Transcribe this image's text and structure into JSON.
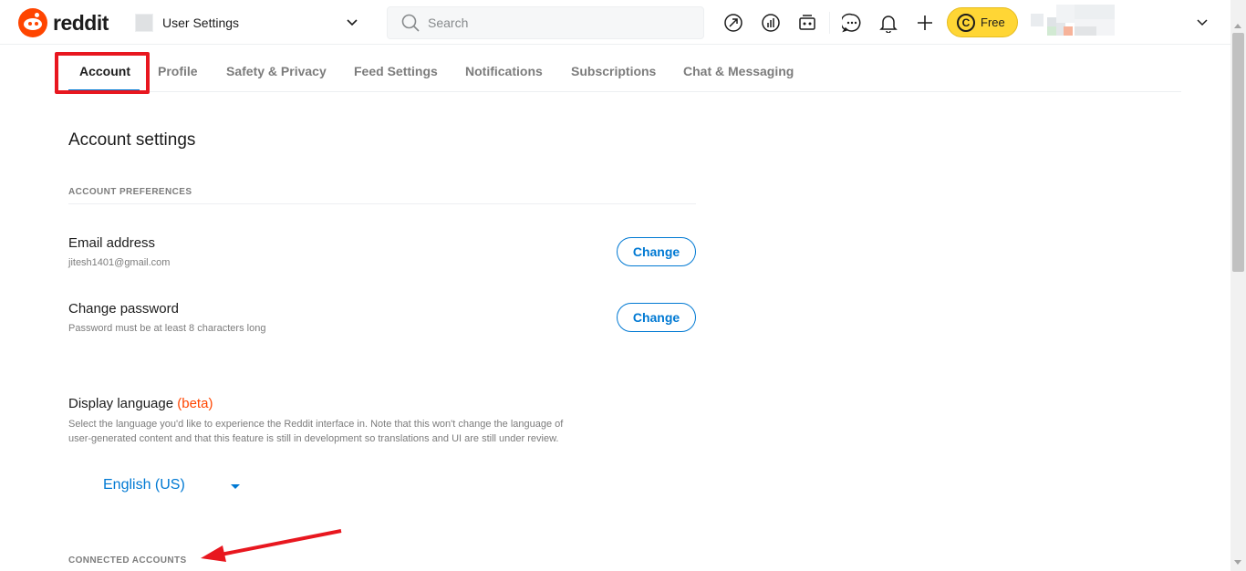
{
  "header": {
    "logo_text": "reddit",
    "community_label": "User Settings",
    "search_placeholder": "Search",
    "coins_label": "Free",
    "coins_symbol": "C"
  },
  "tabs": [
    {
      "label": "Account",
      "active": true
    },
    {
      "label": "Profile",
      "active": false
    },
    {
      "label": "Safety & Privacy",
      "active": false
    },
    {
      "label": "Feed Settings",
      "active": false
    },
    {
      "label": "Notifications",
      "active": false
    },
    {
      "label": "Subscriptions",
      "active": false
    },
    {
      "label": "Chat & Messaging",
      "active": false
    }
  ],
  "page": {
    "title": "Account settings",
    "preferences_header": "ACCOUNT PREFERENCES",
    "email": {
      "title": "Email address",
      "value": "jitesh1401@gmail.com",
      "button": "Change"
    },
    "password": {
      "title": "Change password",
      "hint": "Password must be at least 8 characters long",
      "button": "Change"
    },
    "language": {
      "title": "Display language",
      "badge": "(beta)",
      "description": "Select the language you'd like to experience the Reddit interface in. Note that this won't change the language of user-generated content and that this feature is still in development so translations and UI are still under review.",
      "selected": "English (US)"
    },
    "connected_header": "CONNECTED ACCOUNTS"
  },
  "colors": {
    "accent": "#0079d3",
    "brand": "#ff4500",
    "annotation": "#e8171f",
    "coins": "#ffd635"
  },
  "icons": [
    "popular-icon",
    "stats-icon",
    "video-icon",
    "chat-icon",
    "bell-icon",
    "plus-icon",
    "search-icon",
    "chevron-down-icon",
    "coin-icon"
  ]
}
